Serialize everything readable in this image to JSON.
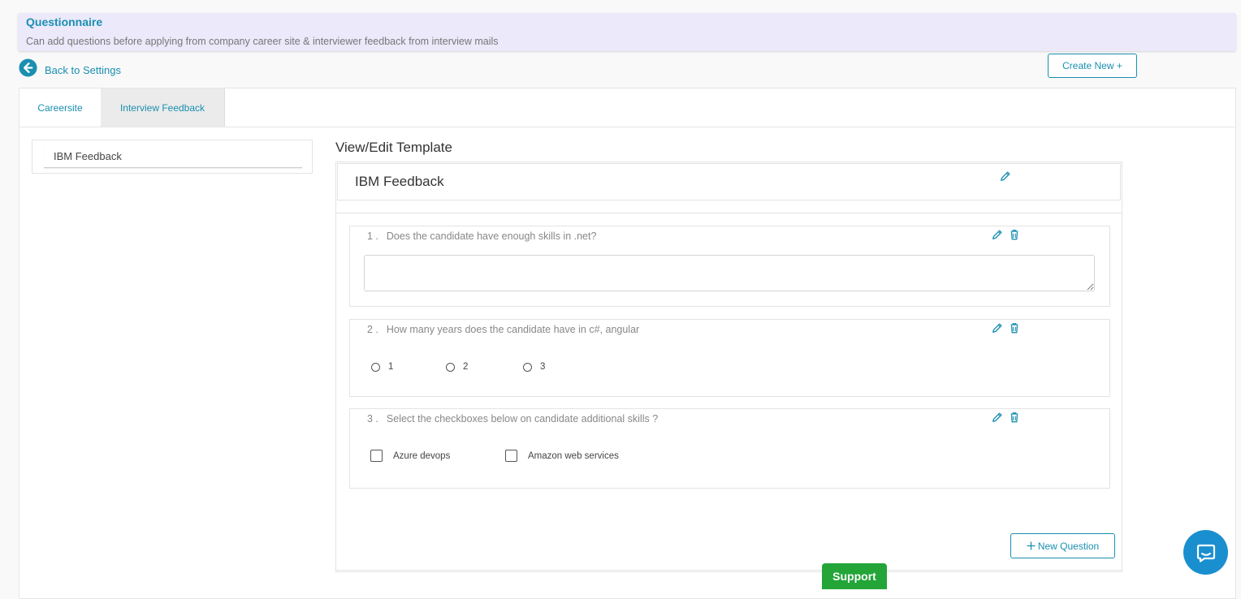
{
  "banner": {
    "title": "Questionnaire",
    "subtitle": "Can add questions before applying from company career site & interviewer feedback from interview mails"
  },
  "nav": {
    "back_label": "Back to Settings",
    "create_label": "Create New +"
  },
  "tabs": [
    {
      "label": "Careersite",
      "active": false
    },
    {
      "label": "Interview Feedback",
      "active": true
    }
  ],
  "templates_list": [
    {
      "label": "IBM Feedback"
    }
  ],
  "editor": {
    "section_title": "View/Edit Template",
    "template_name": "IBM Feedback",
    "new_question_label": "New Question"
  },
  "questions": [
    {
      "number": "1 .",
      "text": "Does the candidate have enough skills in .net?",
      "type": "textarea",
      "value": ""
    },
    {
      "number": "2 .",
      "text": "How many years does the candidate have in c#, angular",
      "type": "radio",
      "options": [
        "1",
        "2",
        "3"
      ]
    },
    {
      "number": "3 .",
      "text": "Select the checkboxes below on candidate additional skills ?",
      "type": "checkbox",
      "options": [
        "Azure devops",
        "Amazon web services"
      ]
    }
  ],
  "support_label": "Support",
  "colors": {
    "accent": "#1a8fb0",
    "banner_bg": "#ebe9fa",
    "support_green": "#23a538",
    "chat_blue": "#1a8fcf"
  },
  "icons": [
    "back-arrow-icon",
    "pencil-icon",
    "trash-icon",
    "plus-icon",
    "chat-icon"
  ]
}
